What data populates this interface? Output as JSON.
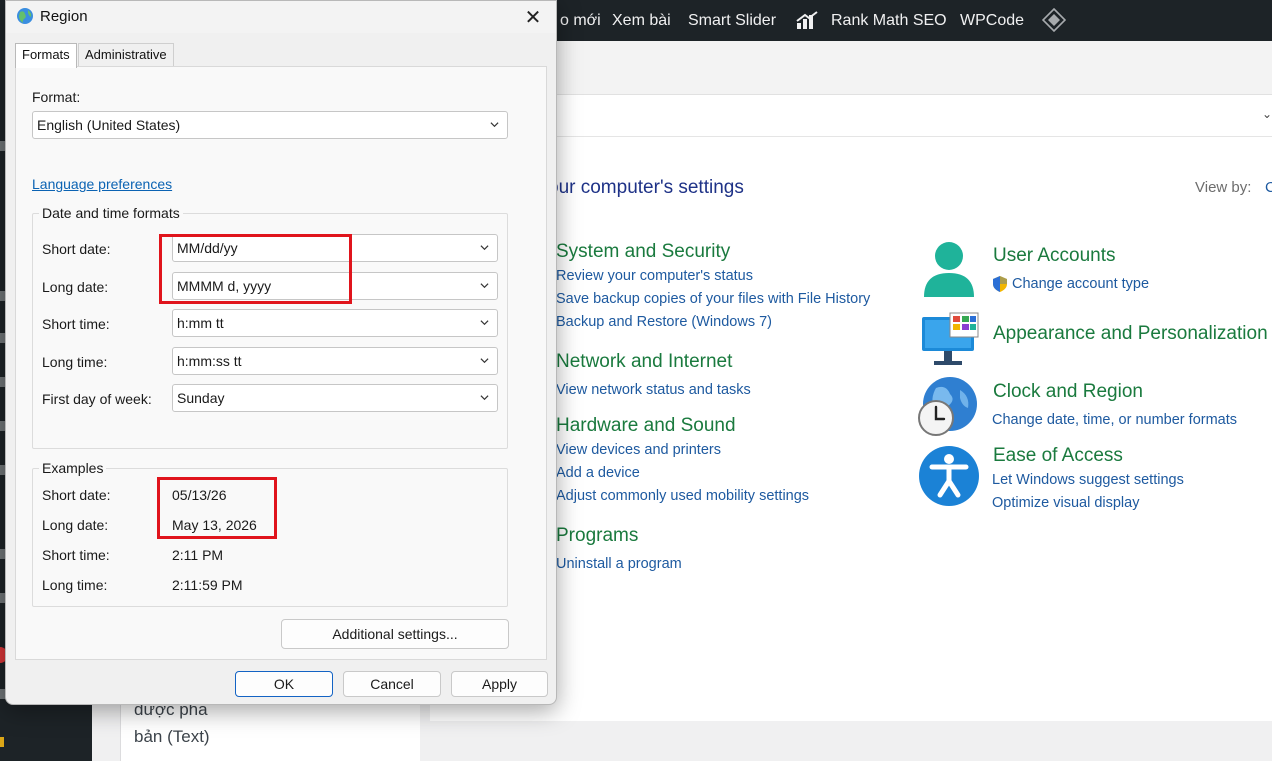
{
  "wp_admin_bar": {
    "items": [
      "o mới",
      "Xem bài",
      "Smart Slider",
      "Rank Math SEO",
      "WPCode"
    ]
  },
  "wp_editor": {
    "line1": "được pha",
    "line2": "bản (Text)"
  },
  "control_panel": {
    "heading": "our computer's settings",
    "view_by_label": "View by:",
    "view_by_value": "C",
    "categories": {
      "system_security": {
        "title": "System and Security",
        "links": [
          "Review your computer's status",
          "Save backup copies of your files with File History",
          "Backup and Restore (Windows 7)"
        ]
      },
      "network": {
        "title": "Network and Internet",
        "links": [
          "View network status and tasks"
        ]
      },
      "hardware": {
        "title": "Hardware and Sound",
        "links": [
          "View devices and printers",
          "Add a device",
          "Adjust commonly used mobility settings"
        ]
      },
      "programs": {
        "title": "Programs",
        "links": [
          "Uninstall a program"
        ]
      },
      "user_accounts": {
        "title": "User Accounts",
        "links": [
          "Change account type"
        ]
      },
      "appearance": {
        "title": "Appearance and Personalization",
        "links": []
      },
      "clock_region": {
        "title": "Clock and Region",
        "links": [
          "Change date, time, or number formats"
        ]
      },
      "ease_access": {
        "title": "Ease of Access",
        "links": [
          "Let Windows suggest settings",
          "Optimize visual display"
        ]
      }
    }
  },
  "dialog": {
    "title": "Region",
    "tabs": [
      "Formats",
      "Administrative"
    ],
    "format_label": "Format:",
    "format_value": "English (United States)",
    "language_link": "Language preferences",
    "dt_group_title": "Date and time formats",
    "rows": [
      {
        "label": "Short date:",
        "value": "MM/dd/yy"
      },
      {
        "label": "Long date:",
        "value": "MMMM d, yyyy"
      },
      {
        "label": "Short time:",
        "value": "h:mm tt"
      },
      {
        "label": "Long time:",
        "value": "h:mm:ss tt"
      },
      {
        "label": "First day of week:",
        "value": "Sunday"
      }
    ],
    "examples_title": "Examples",
    "examples": [
      {
        "label": "Short date:",
        "value": "05/13/26"
      },
      {
        "label": "Long date:",
        "value": "May 13, 2026"
      },
      {
        "label": "Short time:",
        "value": "2:11 PM"
      },
      {
        "label": "Long time:",
        "value": "2:11:59 PM"
      }
    ],
    "additional_settings": "Additional settings...",
    "ok": "OK",
    "cancel": "Cancel",
    "apply": "Apply"
  },
  "colors": {
    "highlight": "#e0141c",
    "category_green": "#1a7a3e",
    "link_blue": "#1e5aa0"
  }
}
